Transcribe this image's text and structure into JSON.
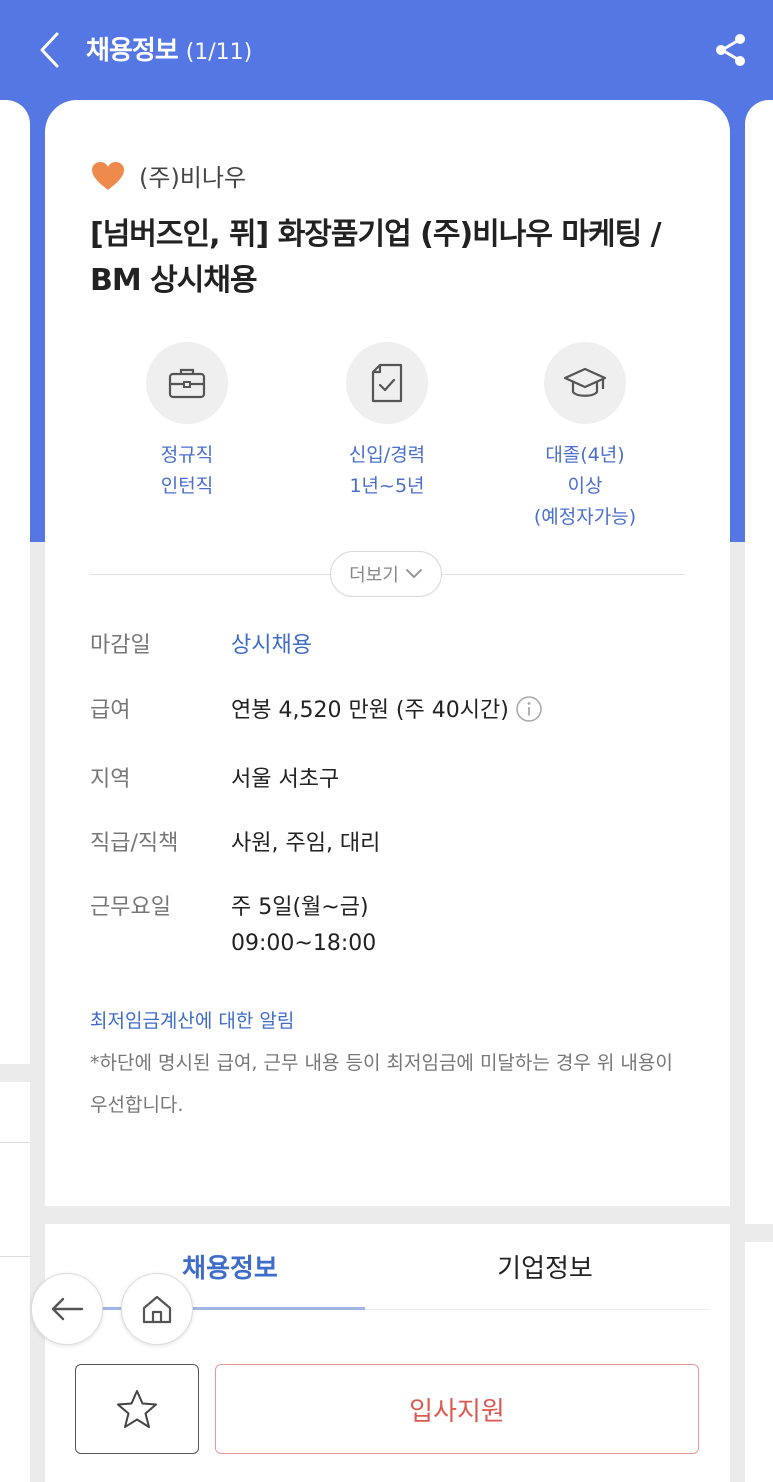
{
  "header": {
    "title": "채용정보",
    "counter": "(1/11)",
    "back_icon": "chevron-left-icon",
    "share_icon": "share-icon"
  },
  "company": {
    "name": "(주)비나우",
    "favorite_icon": "heart-icon",
    "favorite_color": "#ee8a4c"
  },
  "job": {
    "title": "[넘버즈인, 퓌] 화장품기업 (주)비나우 마케팅 / BM 상시채용"
  },
  "features": [
    {
      "icon": "briefcase-icon",
      "lines": [
        "정규직",
        "인턴직"
      ]
    },
    {
      "icon": "document-check-icon",
      "lines": [
        "신입/경력",
        "1년~5년"
      ]
    },
    {
      "icon": "graduation-cap-icon",
      "lines": [
        "대졸(4년)",
        "이상",
        "(예정자가능)"
      ]
    }
  ],
  "more_button": {
    "label": "더보기"
  },
  "info": {
    "deadline": {
      "label": "마감일",
      "value": "상시채용"
    },
    "salary": {
      "label": "급여",
      "value": "연봉 4,520 만원 (주 40시간)"
    },
    "region": {
      "label": "지역",
      "value": "서울 서초구"
    },
    "position": {
      "label": "직급/직책",
      "value": "사원, 주임, 대리"
    },
    "workdays": {
      "label": "근무요일",
      "value": "주 5일(월~금)",
      "value2": "09:00~18:00"
    }
  },
  "notice": {
    "title": "최저임금계산에 대한 알림",
    "text": "*하단에 명시된 급여, 근무 내용 등이 최저임금에 미달하는 경우 위 내용이 우선합니다."
  },
  "tabs": [
    {
      "label": "채용정보",
      "active": true
    },
    {
      "label": "기업정보",
      "active": false
    }
  ],
  "bottom": {
    "apply_label": "입사지원",
    "star_icon": "star-icon"
  },
  "colors": {
    "header_blue": "#5577e3",
    "accent_blue": "#3e6cc8",
    "apply_red": "#dd5a52"
  }
}
